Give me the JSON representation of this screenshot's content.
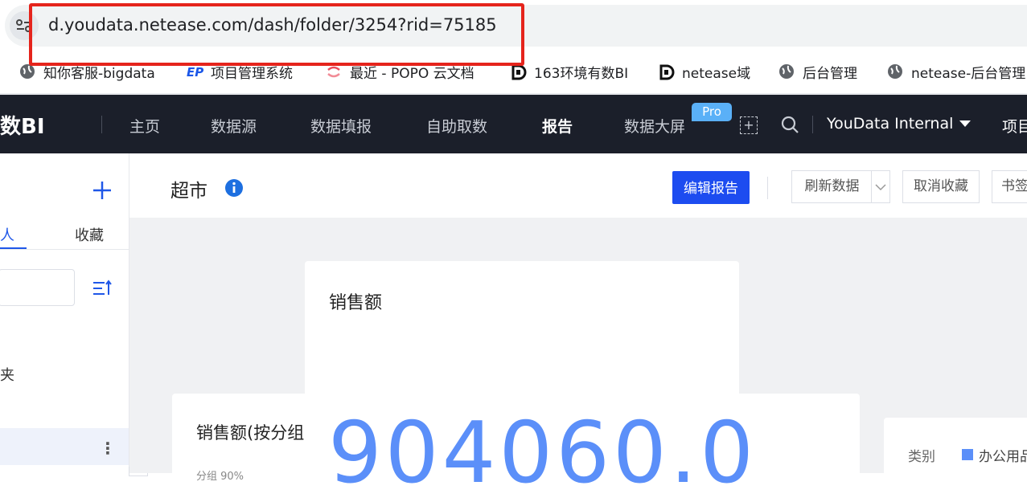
{
  "browser": {
    "url": "d.youdata.netease.com/dash/folder/3254?rid=75185",
    "bookmarks": [
      {
        "label": "知你客服-bigdata",
        "icon": "globe-icon"
      },
      {
        "label": "项目管理系统",
        "icon": "ep-logo-icon"
      },
      {
        "label": "最近 - POPO 云文档",
        "icon": "popo-logo-icon"
      },
      {
        "label": "163环境有数BI",
        "icon": "youdata-logo-icon"
      },
      {
        "label": "netease域",
        "icon": "youdata-logo-icon"
      },
      {
        "label": "后台管理",
        "icon": "globe-icon"
      },
      {
        "label": "netease-后台管理",
        "icon": "globe-icon"
      }
    ]
  },
  "app": {
    "logo": "数BI",
    "nav": [
      "主页",
      "数据源",
      "数据填报",
      "自助取数",
      "报告",
      "数据大屏"
    ],
    "active_nav": "报告",
    "pro_badge": "Pro",
    "workspace": "YouData Internal",
    "project": "项目"
  },
  "sidebar": {
    "tabs": [
      "人",
      "收藏"
    ],
    "folder_label": "夹",
    "more": "⋮"
  },
  "report": {
    "title": "超市",
    "buttons": {
      "edit": "编辑报告",
      "refresh": "刷新数据",
      "unfavorite": "取消收藏",
      "bookmark": "书签"
    },
    "cards": {
      "sales_title": "销售额",
      "sales_value": "904060.0",
      "sales_by_title": "销售额(按分组",
      "sales_by_legend": "分组      90%",
      "category_label": "类别",
      "category_first": "办公用品"
    }
  },
  "colors": {
    "nav_bg": "#1b1f2a",
    "accent": "#1d4cf0",
    "kpi": "#5b8ff9",
    "annotation": "#e5241c"
  }
}
